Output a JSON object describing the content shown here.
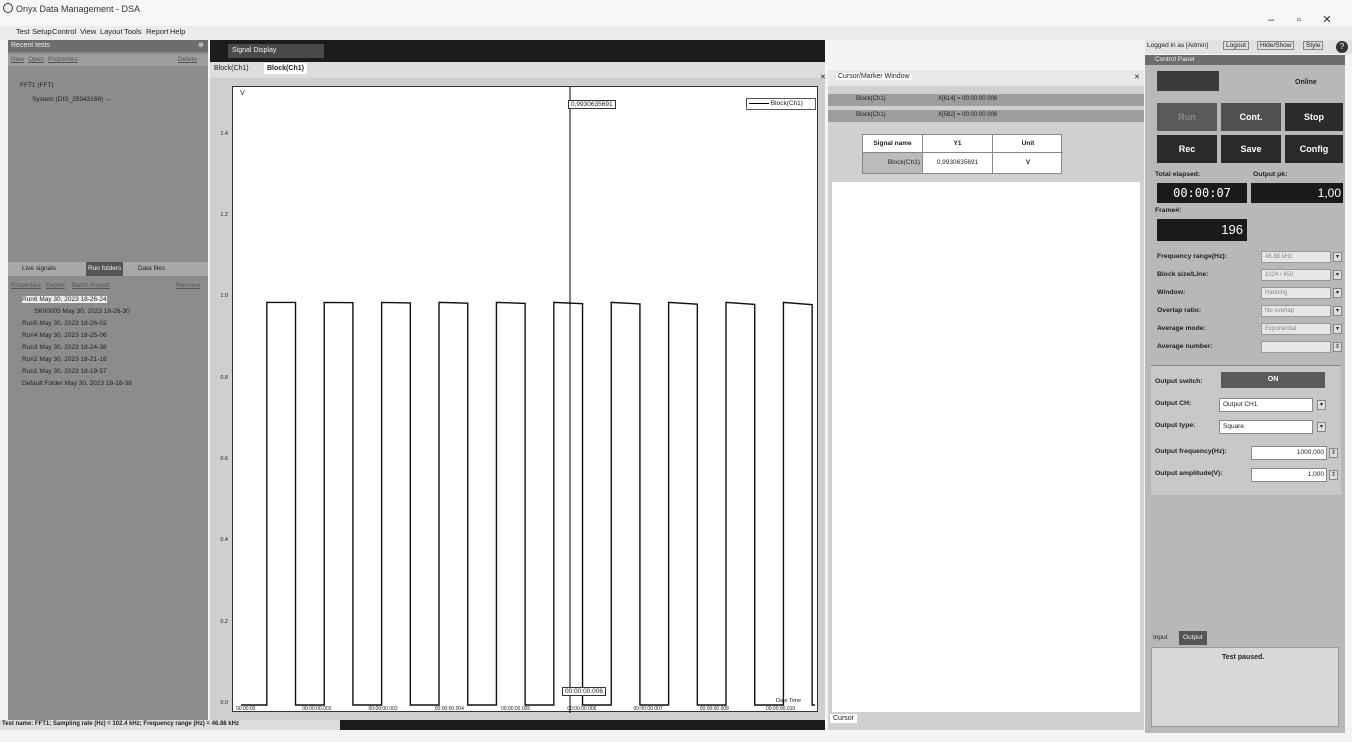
{
  "app": {
    "title": "Onyx Data Management - DSA"
  },
  "menu": [
    "Test",
    "Setup",
    "Control",
    "View",
    "Layout",
    "Tools",
    "Report",
    "Help"
  ],
  "topright": {
    "login": "Logged in as [Admin]",
    "logout": "Logout",
    "hideshow": "Hide/Show",
    "style": "Style"
  },
  "left": {
    "recent_title": "Recent tests",
    "links": {
      "new": "New",
      "open": "Open",
      "properties": "Properties",
      "delete": "Delete"
    },
    "tree_root": "FFT1 (FFT)",
    "tree_child": "System (DIS_25943168) →",
    "tabs": {
      "live": "Live signals",
      "run": "Run folders",
      "data": "Data files"
    },
    "run_links": {
      "properties": "Properties",
      "export": "Export",
      "batch": "Batch Report",
      "remove": "Remove"
    },
    "runs": [
      "Run6 May 30, 2023 18-26-24",
      "SK00005 May 30, 2023 18-26-30",
      "Run5 May 30, 2023 18-26-02",
      "Run4 May 30, 2023 18-25-06",
      "Run3 May 30, 2023 18-24-38",
      "Run2 May 30, 2023 18-21-18",
      "Run1 May 30, 2023 18-19-57",
      "Default Folder May 30, 2023 18-18-38"
    ]
  },
  "signal": {
    "title": "Signal Display",
    "tabs": [
      "Block(Ch1)",
      "Block(Ch1)"
    ],
    "legend": "Block(Ch1)",
    "cursor_value": "0,9930635691",
    "cursor_time": "00:00:00.006",
    "y_unit": "V",
    "yticks": [
      "1.4",
      "1.2",
      "1.0",
      "0.8",
      "0.6",
      "0.4",
      "0.2",
      "0.0"
    ],
    "xticks": [
      "00:00:00",
      "00:00:00.002",
      "00:00:00.003",
      "00:00:00.004",
      "00:00:00.005",
      "00:00:00.006",
      "00:00:00.007",
      "00:00:00.008",
      "00:00:00.010"
    ],
    "x_unit": "Date Time",
    "status": "Test name: FFT1; Sampling rate (Hz) = 102.4 kHz; Frequency range (Hz) = 46.88 kHz"
  },
  "chart_data": {
    "type": "line",
    "series": [
      {
        "name": "Block(Ch1)",
        "high": 0.99,
        "low": 0.0,
        "cycles": 10
      }
    ],
    "ylim": [
      0,
      1.5
    ],
    "ylabel": "V",
    "xlabel": "Date Time"
  },
  "cursor": {
    "title": "Cursor/Marker Window",
    "rows": [
      {
        "name": "Block(Ch1)",
        "val": "X[614] = 00:00:00.006"
      },
      {
        "name": "Block(Ch1)",
        "val": "X[582] = 00:00:00.006"
      }
    ],
    "table": {
      "headers": [
        "Signal name",
        "Y1",
        "Unit"
      ],
      "row": [
        "Block(Ch1)",
        "0,9930635691",
        "V"
      ]
    },
    "bottom_tab": "Cursor"
  },
  "control": {
    "title": "Control Panel",
    "status": "Online",
    "buttons": {
      "run": "Run",
      "cont": "Cont.",
      "stop": "Stop",
      "rec": "Rec",
      "save": "Save",
      "config": "Config"
    },
    "elapsed_label": "Total elapsed:",
    "elapsed": "00:00:07",
    "output_label": "Output pk:",
    "output": "1,00",
    "frame_label": "Frame#:",
    "frame": "196",
    "params": [
      {
        "label": "Frequency range(Hz):",
        "value": "46.88 kHz"
      },
      {
        "label": "Block size/Line:",
        "value": "1024 / 450"
      },
      {
        "label": "Window:",
        "value": "Hanning"
      },
      {
        "label": "Overlap ratio:",
        "value": "No overlap"
      },
      {
        "label": "Average mode:",
        "value": "Exponential"
      },
      {
        "label": "Average number:",
        "value": ""
      }
    ],
    "output_switch_label": "Output switch:",
    "output_switch": "ON",
    "output_ch_label": "Output CH:",
    "output_ch": "Output CH1",
    "output_type_label": "Output type:",
    "output_type": "Square",
    "output_freq_label": "Output frequency(Hz):",
    "output_freq": "1000,000",
    "output_amp_label": "Output amplitude(V):",
    "output_amp": "1,000",
    "tabs": {
      "input": "Input",
      "output": "Output"
    },
    "message": "Test paused."
  },
  "colors": {
    "dark_btn": "#4a4a4a",
    "panel": "#b8b8b8",
    "display": "#1c1c1c"
  }
}
